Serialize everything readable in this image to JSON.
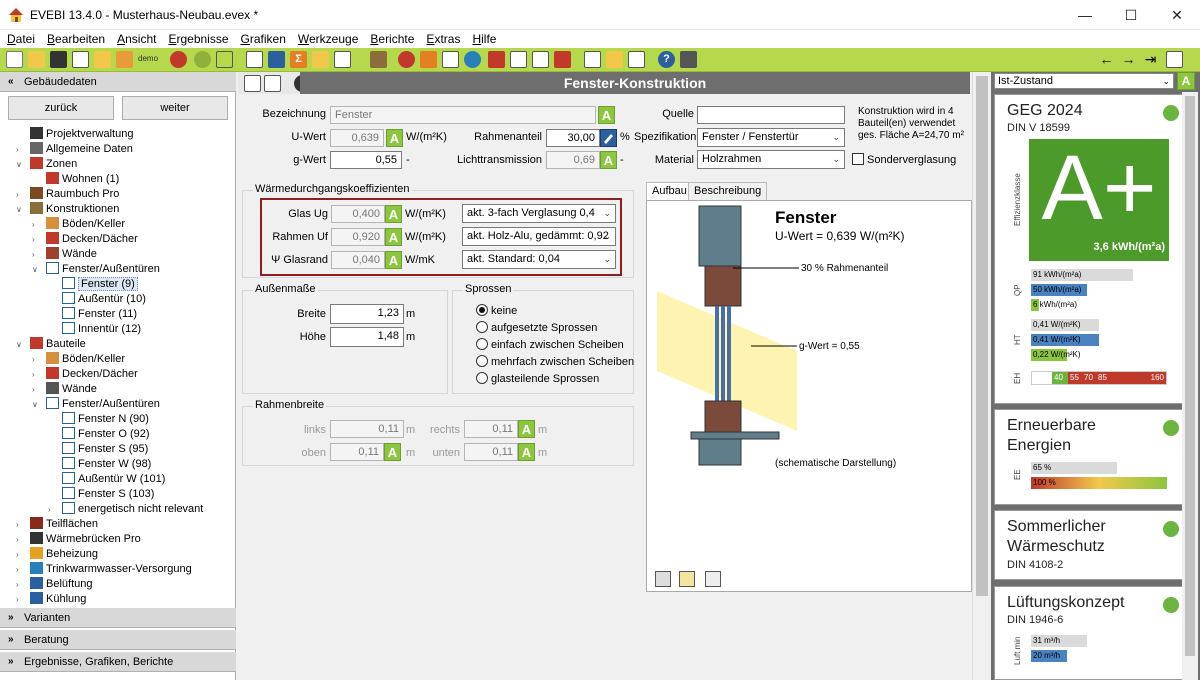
{
  "window": {
    "title": "EVEBI 13.4.0 - Musterhaus-Neubau.evex *"
  },
  "menu": [
    "Datei",
    "Bearbeiten",
    "Ansicht",
    "Ergebnisse",
    "Grafiken",
    "Werkzeuge",
    "Berichte",
    "Extras",
    "Hilfe"
  ],
  "toolbar": {
    "small_label": "demo"
  },
  "left": {
    "header": "Gebäudedaten",
    "back": "zurück",
    "forward": "weiter",
    "tree": [
      {
        "label": "Projektverwaltung",
        "icon": "clock-icon",
        "level": 1,
        "exp": ""
      },
      {
        "label": "Allgemeine Daten",
        "icon": "document-icon",
        "level": 1,
        "exp": ">"
      },
      {
        "label": "Zonen",
        "icon": "house-icon",
        "level": 1,
        "exp": "v"
      },
      {
        "label": "Wohnen (1)",
        "icon": "house-icon",
        "level": 2,
        "exp": ""
      },
      {
        "label": "Raumbuch Pro",
        "icon": "book-icon",
        "level": 1,
        "exp": ">"
      },
      {
        "label": "Konstruktionen",
        "icon": "layers-icon",
        "level": 1,
        "exp": "v"
      },
      {
        "label": "Böden/Keller",
        "icon": "floor-icon",
        "level": 2,
        "exp": ">"
      },
      {
        "label": "Decken/Dächer",
        "icon": "roof-icon",
        "level": 2,
        "exp": ">"
      },
      {
        "label": "Wände",
        "icon": "wall-icon",
        "level": 2,
        "exp": ">"
      },
      {
        "label": "Fenster/Außentüren",
        "icon": "window-icon",
        "level": 2,
        "exp": "v"
      },
      {
        "label": "Fenster (9)",
        "icon": "window-icon",
        "level": 3,
        "exp": "",
        "selected": true
      },
      {
        "label": "Außentür (10)",
        "icon": "door-icon",
        "level": 3,
        "exp": ""
      },
      {
        "label": "Fenster (11)",
        "icon": "window-icon",
        "level": 3,
        "exp": ""
      },
      {
        "label": "Innentür (12)",
        "icon": "door-icon",
        "level": 3,
        "exp": ""
      },
      {
        "label": "Bauteile",
        "icon": "house-icon",
        "level": 1,
        "exp": "v"
      },
      {
        "label": "Böden/Keller",
        "icon": "floor-icon",
        "level": 2,
        "exp": ">"
      },
      {
        "label": "Decken/Dächer",
        "icon": "roof-icon",
        "level": 2,
        "exp": ">"
      },
      {
        "label": "Wände",
        "icon": "house-outline-icon",
        "level": 2,
        "exp": ">"
      },
      {
        "label": "Fenster/Außentüren",
        "icon": "window-icon",
        "level": 2,
        "exp": "v"
      },
      {
        "label": "Fenster N (90)",
        "icon": "window-icon",
        "level": 3,
        "exp": ""
      },
      {
        "label": "Fenster O (92)",
        "icon": "window-icon",
        "level": 3,
        "exp": ""
      },
      {
        "label": "Fenster S (95)",
        "icon": "window-icon",
        "level": 3,
        "exp": ""
      },
      {
        "label": "Fenster W (98)",
        "icon": "window-icon",
        "level": 3,
        "exp": ""
      },
      {
        "label": "Außentür W (101)",
        "icon": "door-icon",
        "level": 3,
        "exp": ""
      },
      {
        "label": "Fenster S (103)",
        "icon": "window-icon",
        "level": 3,
        "exp": ""
      },
      {
        "label": "energetisch nicht relevant",
        "icon": "window-icon",
        "level": 3,
        "exp": ">"
      },
      {
        "label": "Teilflächen",
        "icon": "grid-icon",
        "level": 1,
        "exp": ">"
      },
      {
        "label": "Wärmebrücken Pro",
        "icon": "bridge-icon",
        "level": 1,
        "exp": ">"
      },
      {
        "label": "Beheizung",
        "icon": "heater-icon",
        "level": 1,
        "exp": ">"
      },
      {
        "label": "Trinkwarmwasser-Versorgung",
        "icon": "water-drop-icon",
        "level": 1,
        "exp": ">"
      },
      {
        "label": "Belüftung",
        "icon": "fan-icon",
        "level": 1,
        "exp": ">"
      },
      {
        "label": "Kühlung",
        "icon": "snowflake-icon",
        "level": 1,
        "exp": ">"
      }
    ],
    "footer": [
      "Varianten",
      "Beratung",
      "Ergebnisse, Grafiken, Berichte"
    ]
  },
  "center": {
    "title": "Fenster-Konstruktion",
    "bezeichnung_label": "Bezeichnung",
    "bezeichnung": "Fenster",
    "uwert_label": "U-Wert",
    "uwert": "0,639",
    "uwert_unit": "W/(m²K)",
    "gwert_label": "g-Wert",
    "gwert": "0,55",
    "gwert_unit": "-",
    "rahmenanteil_label": "Rahmenanteil",
    "rahmenanteil": "30,00",
    "rahmenanteil_unit": "%",
    "licht_label": "Lichttransmission",
    "licht": "0,69",
    "licht_unit": "-",
    "quelle_label": "Quelle",
    "quelle": "",
    "spez_label": "Spezifikation",
    "spez": "Fenster / Fenstertür",
    "material_label": "Material",
    "material": "Holzrahmen",
    "info": "Konstruktion wird in 4 Bauteil(en) verwendet ges. Fläche A=24,70 m²",
    "sonder": "Sonderverglasung",
    "wk_title": "Wärmedurchgangskoeffizienten",
    "glas_label": "Glas Ug",
    "glas": "0,400",
    "glas_unit": "W/(m²K)",
    "glas_sel": "akt. 3-fach Verglasung 0,4",
    "rahmen_label": "Rahmen Uf",
    "rahmen": "0,920",
    "rahmen_unit": "W/(m²K)",
    "rahmen_sel": "akt. Holz-Alu, gedämmt: 0,92",
    "rand_label": "Ψ Glasrand",
    "rand": "0,040",
    "rand_unit": "W/mK",
    "rand_sel": "akt. Standard: 0,04",
    "am_title": "Außenmaße",
    "breite_label": "Breite",
    "breite": "1,23",
    "breite_unit": "m",
    "hoehe_label": "Höhe",
    "hoehe": "1,48",
    "hoehe_unit": "m",
    "sprossen_title": "Sprossen",
    "sprossen": [
      "keine",
      "aufgesetzte Sprossen",
      "einfach zwischen Scheiben",
      "mehrfach zwischen Scheiben",
      "glasteilende Sprossen"
    ],
    "rb_title": "Rahmenbreite",
    "links_label": "links",
    "links": "0,11",
    "rechts_label": "rechts",
    "rechts": "0,11",
    "oben_label": "oben",
    "oben": "0,11",
    "unten_label": "unten",
    "unten": "0,11",
    "unit_m": "m",
    "tab_aufbau": "Aufbau",
    "tab_beschreibung": "Beschreibung",
    "fig_title": "Fenster",
    "fig_u": "U-Wert = 0,639 W/(m²K)",
    "fig_rahmen": "30 % Rahmenanteil",
    "fig_g": "g-Wert = 0,55",
    "fig_note": "(schematische Darstellung)"
  },
  "right": {
    "state": "Ist-Zustand",
    "geg_title": "GEG 2024",
    "geg_sub": "DIN V 18599",
    "rating": "A+",
    "rating_value": "3,6 kWh/(m²a)",
    "rating_axis": "Effizienzklasse",
    "qp_label": "QP",
    "qp_bars": [
      "91 kWh/(m²a)",
      "50 kWh/(m²a)",
      "6 kWh/(m²a)"
    ],
    "ht_label": "HT",
    "ht_bars": [
      "0,41 W/(m²K)",
      "0,41 W/(m²K)",
      "0,22 W/(m²K)"
    ],
    "eh_label": "EH",
    "eh_values": [
      "40",
      "55",
      "70",
      "85",
      "160"
    ],
    "ee_title1": "Erneuerbare",
    "ee_title2": "Energien",
    "ee_label": "EE",
    "ee_bars": [
      "65 %",
      "100 %"
    ],
    "sw_title1": "Sommerlicher",
    "sw_title2": "Wärmeschutz",
    "sw_sub": "DIN 4108-2",
    "lk_title": "Lüftungskonzept",
    "lk_sub": "DIN 1946-6",
    "lk_label": "Luft min",
    "lk_bars": [
      "31 m³/h",
      "20 m³/h"
    ]
  },
  "colors": {
    "accent_green": "#8cc63e",
    "toolbar_green": "#b5d84d",
    "header_gray": "#6e6e6e",
    "rating_green": "#4c9a2a"
  }
}
